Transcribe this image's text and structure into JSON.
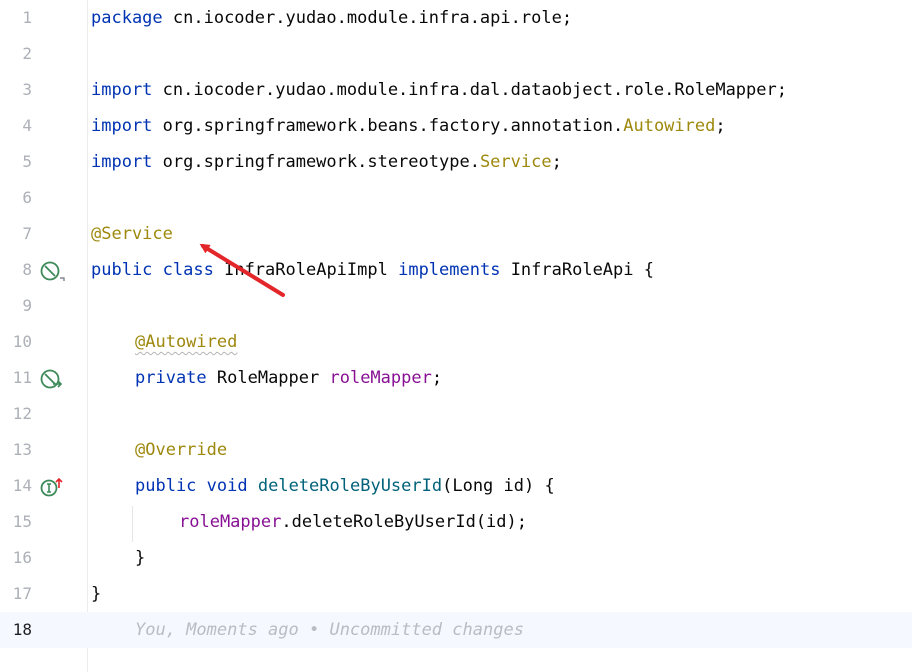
{
  "editor": {
    "current_line": 18,
    "lines": [
      {
        "num": "1",
        "tokens": [
          {
            "t": "package",
            "c": "kw"
          },
          {
            "t": " cn.iocoder.yudao.module.infra.api.role;",
            "c": ""
          }
        ]
      },
      {
        "num": "2",
        "tokens": []
      },
      {
        "num": "3",
        "tokens": [
          {
            "t": "import",
            "c": "kw"
          },
          {
            "t": " cn.iocoder.yudao.module.infra.dal.dataobject.role.RoleMapper;",
            "c": ""
          }
        ]
      },
      {
        "num": "4",
        "tokens": [
          {
            "t": "import",
            "c": "kw"
          },
          {
            "t": " org.springframework.beans.factory.annotation.",
            "c": ""
          },
          {
            "t": "Autowired",
            "c": "ann"
          },
          {
            "t": ";",
            "c": ""
          }
        ]
      },
      {
        "num": "5",
        "tokens": [
          {
            "t": "import",
            "c": "kw"
          },
          {
            "t": " org.springframework.stereotype.",
            "c": ""
          },
          {
            "t": "Service",
            "c": "ann"
          },
          {
            "t": ";",
            "c": ""
          }
        ]
      },
      {
        "num": "6",
        "tokens": []
      },
      {
        "num": "7",
        "tokens": [
          {
            "t": "@Service",
            "c": "ann"
          }
        ]
      },
      {
        "num": "8",
        "icon": "bean-icon",
        "tokens": [
          {
            "t": "public",
            "c": "kw"
          },
          {
            "t": " ",
            "c": ""
          },
          {
            "t": "class",
            "c": "kw"
          },
          {
            "t": " InfraRoleApiImpl ",
            "c": ""
          },
          {
            "t": "implements",
            "c": "kw"
          },
          {
            "t": " InfraRoleApi {",
            "c": ""
          }
        ]
      },
      {
        "num": "9",
        "tokens": []
      },
      {
        "num": "10",
        "indent": 1,
        "tokens": [
          {
            "t": "@Autowired",
            "c": "ann warn-underline"
          }
        ]
      },
      {
        "num": "11",
        "indent": 1,
        "icon": "autowired-bean-icon",
        "tokens": [
          {
            "t": "private",
            "c": "kw"
          },
          {
            "t": " RoleMapper ",
            "c": ""
          },
          {
            "t": "roleMapper",
            "c": "fld"
          },
          {
            "t": ";",
            "c": ""
          }
        ]
      },
      {
        "num": "12",
        "tokens": []
      },
      {
        "num": "13",
        "indent": 1,
        "tokens": [
          {
            "t": "@Override",
            "c": "ann"
          }
        ]
      },
      {
        "num": "14",
        "indent": 1,
        "icon": "implements-method-icon",
        "tokens": [
          {
            "t": "public",
            "c": "kw"
          },
          {
            "t": " ",
            "c": ""
          },
          {
            "t": "void",
            "c": "kw"
          },
          {
            "t": " ",
            "c": ""
          },
          {
            "t": "deleteRoleByUserId",
            "c": "fn"
          },
          {
            "t": "(Long id) {",
            "c": ""
          }
        ]
      },
      {
        "num": "15",
        "indent": 2,
        "tokens": [
          {
            "t": "roleMapper",
            "c": "fld"
          },
          {
            "t": ".deleteRoleByUserId(id);",
            "c": ""
          }
        ]
      },
      {
        "num": "16",
        "indent": 1,
        "tokens": [
          {
            "t": "}",
            "c": ""
          }
        ]
      },
      {
        "num": "17",
        "tokens": [
          {
            "t": "}",
            "c": ""
          }
        ]
      },
      {
        "num": "18",
        "indent": 1,
        "tokens": [
          {
            "t": "You, Moments ago • Uncommitted changes",
            "c": "blame"
          }
        ]
      }
    ]
  },
  "colors": {
    "keyword": "#0033b3",
    "annotation": "#9e880d",
    "field": "#871094",
    "method": "#00627a",
    "arrow": "#e3262a",
    "gutter_icon": "#3d8a58"
  }
}
